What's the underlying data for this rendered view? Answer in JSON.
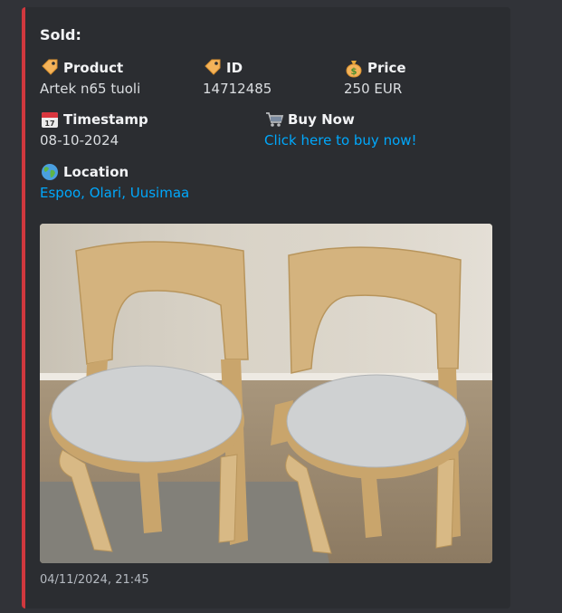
{
  "embed": {
    "title": "Sold:",
    "accent_color": "#d0383e",
    "fields": {
      "product": {
        "icon": "label-tag-icon",
        "name": "Product",
        "value": "Artek n65 tuoli"
      },
      "id": {
        "icon": "label-tag-icon",
        "name": "ID",
        "value": "14712485"
      },
      "price": {
        "icon": "money-bag-icon",
        "name": "Price",
        "value": "250 EUR"
      },
      "timestamp": {
        "icon": "calendar-icon",
        "name": "Timestamp",
        "value": "08-10-2024"
      },
      "buy_now": {
        "icon": "shopping-cart-icon",
        "name": "Buy Now",
        "value": "Click here to buy now!"
      },
      "location": {
        "icon": "globe-icon",
        "name": "Location",
        "value": "Espoo, Olari, Uusimaa"
      }
    },
    "image": {
      "subject": "two bentwood chairs with white round seats"
    },
    "footer": {
      "timestamp": "04/11/2024, 21:45"
    }
  }
}
